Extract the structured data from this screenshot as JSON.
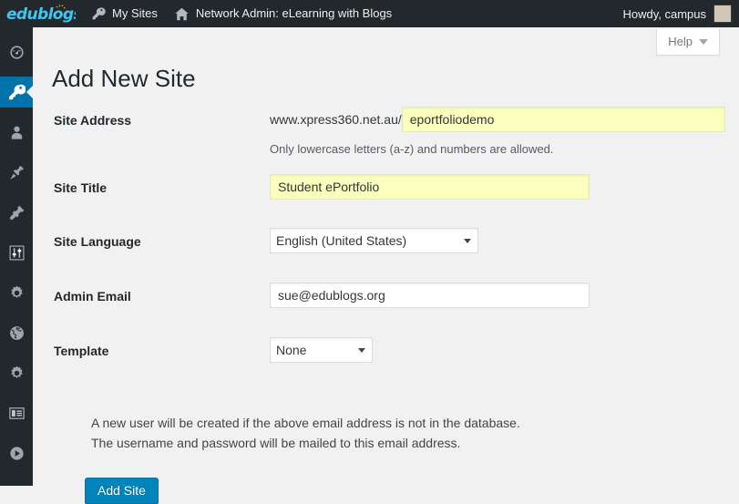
{
  "adminbar": {
    "logo": {
      "name": "edublogs",
      "text": "edublogs",
      "color": "#3ec6f0",
      "sun_color": "#f5a623"
    },
    "items": [
      {
        "icon": "key-icon",
        "label": "My Sites"
      },
      {
        "icon": "home-icon",
        "label": "Network Admin: eLearning with Blogs"
      }
    ],
    "howdy": "Howdy, campus",
    "avatar_name": "avatar"
  },
  "sidebar": {
    "items": [
      {
        "icon": "dashboard-icon",
        "name": "sidebar-item-dashboard",
        "current": false
      },
      {
        "icon": "key-icon",
        "name": "sidebar-item-sites",
        "current": true
      },
      {
        "icon": "user-icon",
        "name": "sidebar-item-users",
        "current": false
      },
      {
        "icon": "thumbtack-icon",
        "name": "sidebar-item-themes",
        "current": false
      },
      {
        "icon": "plug-icon",
        "name": "sidebar-item-plugins",
        "current": false
      },
      {
        "icon": "sliders-icon",
        "name": "sidebar-item-tools",
        "current": false
      },
      {
        "icon": "gear-icon",
        "name": "sidebar-item-settings",
        "current": false
      },
      {
        "icon": "globe-icon",
        "name": "sidebar-item-network",
        "current": false
      },
      {
        "icon": "gear-icon",
        "name": "sidebar-item-options",
        "current": false
      },
      {
        "icon": "list-card-icon",
        "name": "sidebar-item-pages",
        "current": false
      },
      {
        "icon": "play-circle-icon",
        "name": "sidebar-item-media",
        "current": false
      }
    ]
  },
  "help": {
    "label": "Help",
    "icon": "chevron-down-icon"
  },
  "page": {
    "title": "Add New Site"
  },
  "form": {
    "site_address": {
      "label": "Site Address",
      "prefix": "www.xpress360.net.au/",
      "value": "eportfoliodemo",
      "placeholder": "",
      "description": "Only lowercase letters (a-z) and numbers are allowed."
    },
    "site_title": {
      "label": "Site Title",
      "value": "Student ePortfolio",
      "placeholder": ""
    },
    "site_language": {
      "label": "Site Language",
      "value": "English (United States)",
      "options": [
        "English (United States)"
      ]
    },
    "admin_email": {
      "label": "Admin Email",
      "value": "sue@edublogs.org",
      "placeholder": ""
    },
    "template": {
      "label": "Template",
      "value": "None",
      "options": [
        "None"
      ]
    }
  },
  "note": {
    "line1": "A new user will be created if the above email address is not in the database.",
    "line2": "The username and password will be mailed to this email address."
  },
  "submit": {
    "label": "Add Site",
    "color": "#0085ba"
  }
}
